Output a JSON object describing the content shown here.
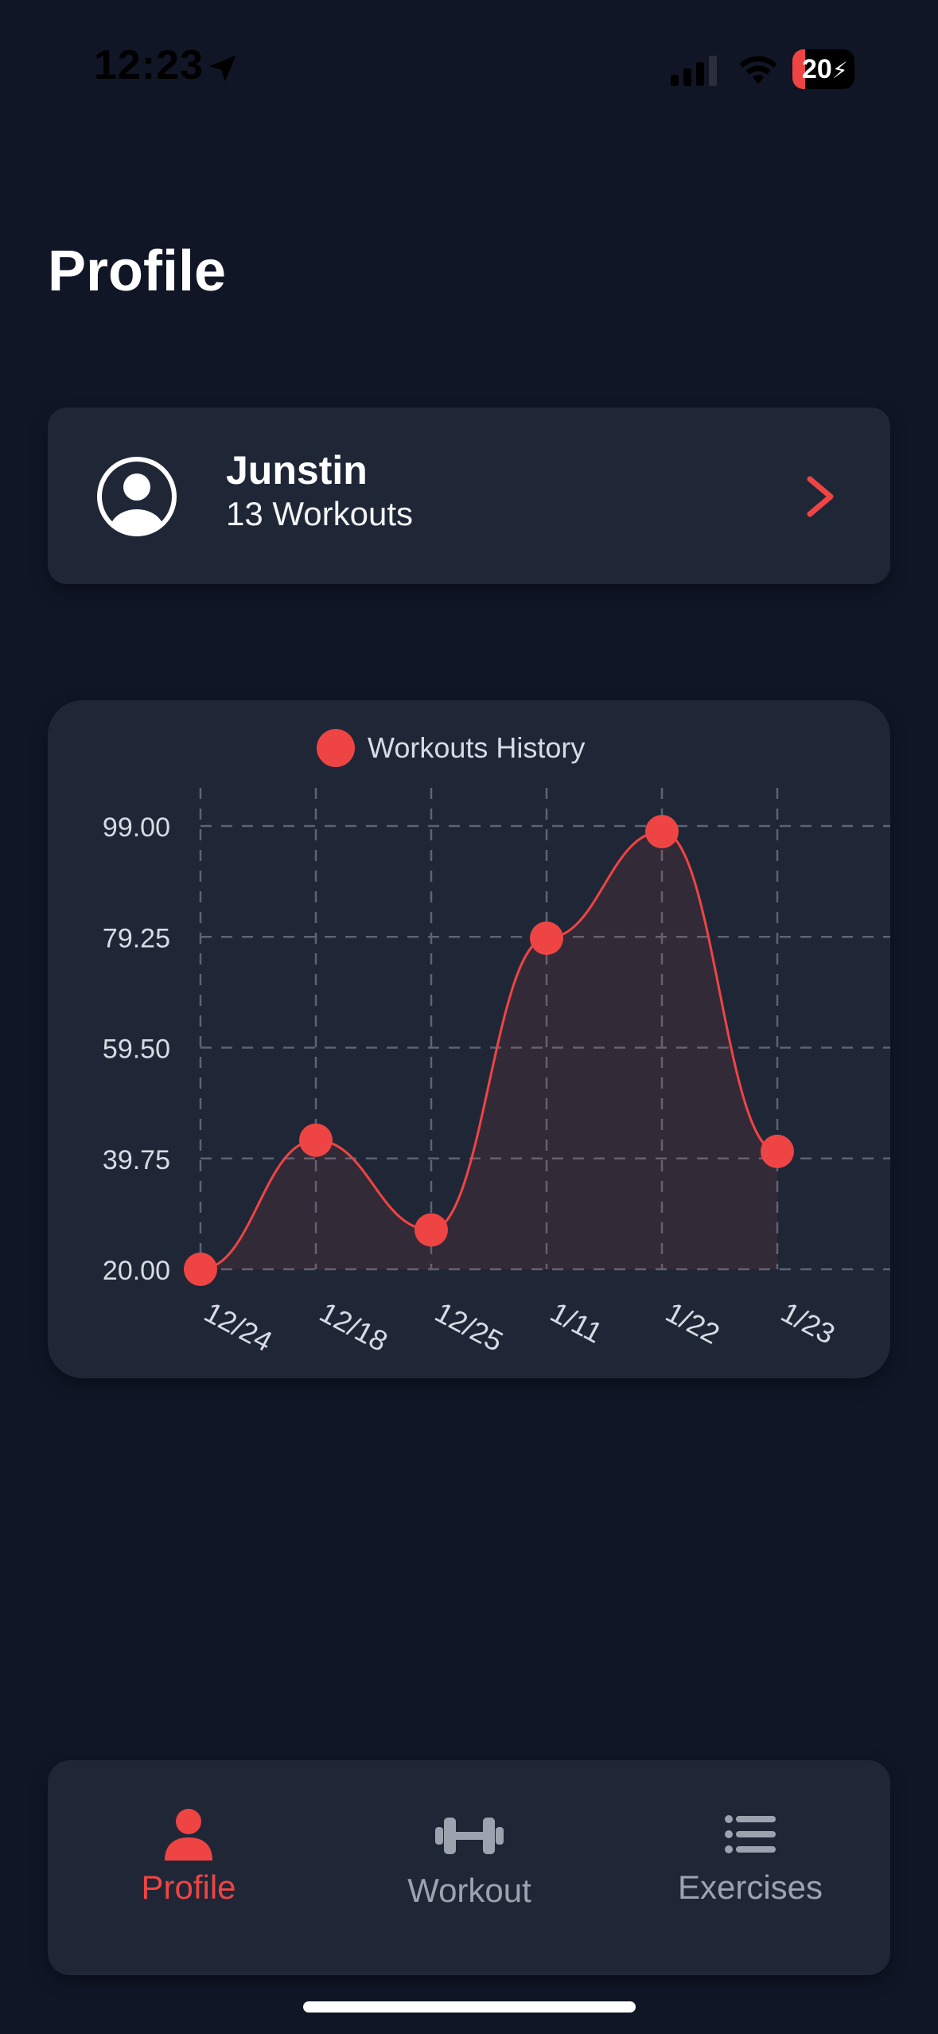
{
  "status_bar": {
    "time": "12:23",
    "battery_level": "20",
    "icons": [
      "location-arrow-icon",
      "cellular-signal-icon",
      "wifi-icon",
      "battery-charging-icon"
    ]
  },
  "header": {
    "title": "Profile"
  },
  "profile_card": {
    "name": "Junstin",
    "workouts": "13 Workouts",
    "avatar_icon": "user-circle-icon",
    "chevron_icon": "chevron-right-icon"
  },
  "theme": {
    "accent": "#ef4444",
    "background": "#101626",
    "card": "#1f2737",
    "inactive": "#9ca3af"
  },
  "chart_data": {
    "type": "area",
    "title": "",
    "legend": "Workouts History",
    "legend_position": "top-center",
    "grid": true,
    "smooth": true,
    "categories": [
      "12/24",
      "12/18",
      "12/25",
      "1/11",
      "1/22",
      "1/23"
    ],
    "series": [
      {
        "name": "Workouts History",
        "values": [
          20,
          43,
          27,
          79,
          98,
          41
        ]
      }
    ],
    "ylim": [
      20,
      99
    ],
    "yticks": [
      "20.00",
      "39.75",
      "59.50",
      "79.25",
      "99.00"
    ],
    "xlabel": "",
    "ylabel": ""
  },
  "tab_bar": {
    "tabs": [
      {
        "label": "Profile",
        "icon": "person-icon",
        "active": true
      },
      {
        "label": "Workout",
        "icon": "dumbbell-icon",
        "active": false
      },
      {
        "label": "Exercises",
        "icon": "list-icon",
        "active": false
      }
    ]
  }
}
